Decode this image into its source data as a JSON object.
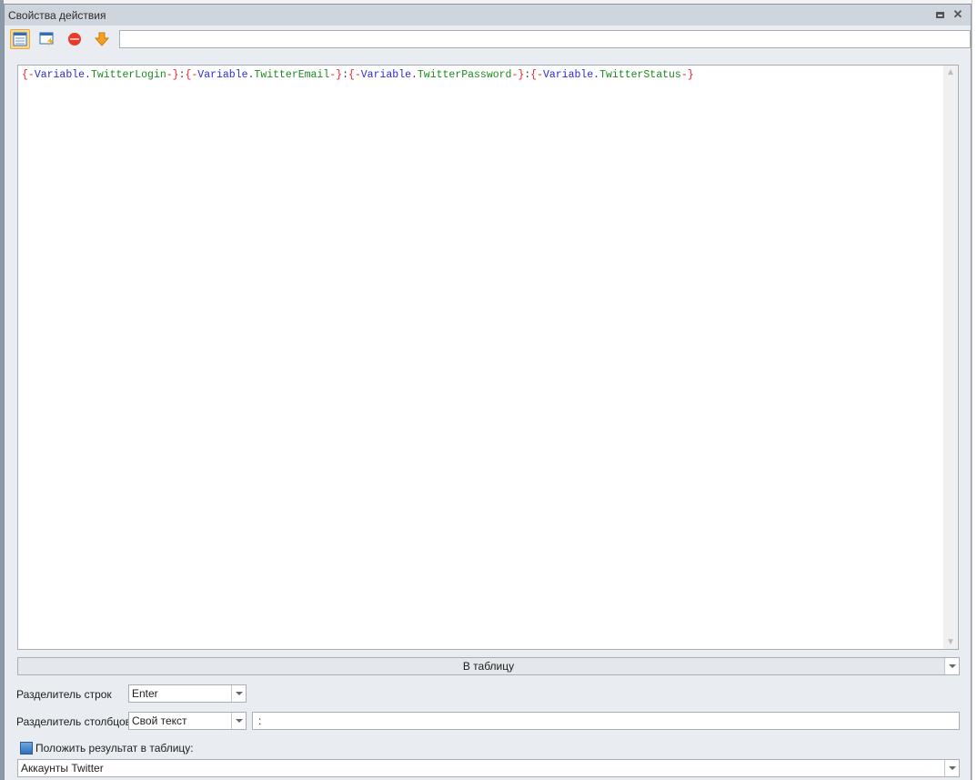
{
  "window": {
    "title": "Свойства действия"
  },
  "toolbar": {
    "search_value": "",
    "icons": [
      "table-view-icon",
      "window-lightning-icon",
      "stop-icon",
      "arrow-down-icon"
    ]
  },
  "editor": {
    "tokens": [
      {
        "t": "{-",
        "c": "r"
      },
      {
        "t": "Variable.",
        "c": "b"
      },
      {
        "t": "TwitterLogin",
        "c": "g"
      },
      {
        "t": "-}",
        "c": "r"
      },
      {
        "t": ":",
        "c": "k"
      },
      {
        "t": "{-",
        "c": "r"
      },
      {
        "t": "Variable.",
        "c": "b"
      },
      {
        "t": "TwitterEmail",
        "c": "g"
      },
      {
        "t": "-}",
        "c": "r"
      },
      {
        "t": ":",
        "c": "k"
      },
      {
        "t": "{-",
        "c": "r"
      },
      {
        "t": "Variable.",
        "c": "b"
      },
      {
        "t": "TwitterPassword",
        "c": "g"
      },
      {
        "t": "-}",
        "c": "r"
      },
      {
        "t": ":",
        "c": "k"
      },
      {
        "t": "{-",
        "c": "r"
      },
      {
        "t": "Variable.",
        "c": "b"
      },
      {
        "t": "TwitterStatus",
        "c": "g"
      },
      {
        "t": "-}",
        "c": "r"
      }
    ]
  },
  "mode": {
    "selected": "В таблицу"
  },
  "row_sep": {
    "label": "Разделитель строк",
    "value": "Enter"
  },
  "col_sep": {
    "label": "Разделитель столбцов",
    "value": "Свой текст",
    "custom": ":"
  },
  "put_result": {
    "label": "Положить результат в таблицу:",
    "checked": true,
    "table": "Аккаунты Twitter"
  },
  "colors": {
    "accent": "#fbd98c",
    "title_bar": "#cfd5dd"
  }
}
